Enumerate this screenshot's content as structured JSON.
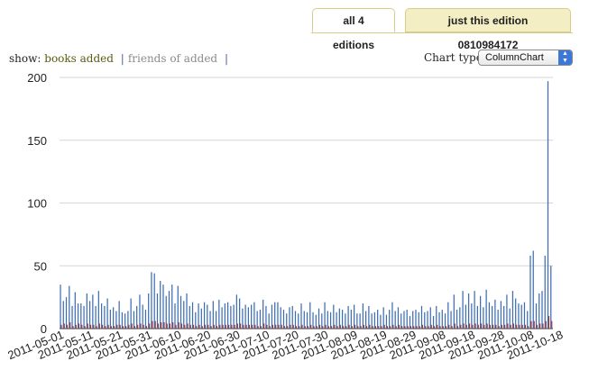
{
  "tabs": [
    {
      "label": "all 4 editions",
      "active": true
    },
    {
      "label": "just this edition 0810984172",
      "active": false
    }
  ],
  "show": {
    "label": "show:",
    "options": [
      "books added",
      "friends of added"
    ],
    "separator": "|"
  },
  "chart_type": {
    "label": "Chart type",
    "selected": "ColumnChart"
  },
  "colors": {
    "series_books": "#3d6db3",
    "series_friends": "#9e3b3b",
    "grid": "#d6d6d6",
    "axis_text": "#222222"
  },
  "chart_data": {
    "type": "bar",
    "ylim": [
      0,
      200
    ],
    "yticks": [
      0,
      50,
      100,
      150,
      200
    ],
    "grid": true,
    "xtick_labels": [
      "2011-05-01",
      "2011-05-11",
      "2011-05-21",
      "2011-05-31",
      "2011-06-10",
      "2011-06-20",
      "2011-06-30",
      "2011-07-10",
      "2011-07-20",
      "2011-07-30",
      "2011-08-09",
      "2011-08-19",
      "2011-08-29",
      "2011-09-08",
      "2011-09-18",
      "2011-09-28",
      "2011-10-08",
      "2011-10-18"
    ],
    "start_date": "2011-05-01",
    "series": [
      {
        "values": [
          35,
          22,
          25,
          34,
          18,
          29,
          20,
          20,
          18,
          28,
          22,
          27,
          18,
          30,
          20,
          18,
          24,
          15,
          17,
          14,
          22,
          13,
          12,
          14,
          24,
          14,
          18,
          27,
          19,
          15,
          28,
          45,
          44,
          28,
          38,
          35,
          26,
          30,
          35,
          20,
          34,
          26,
          22,
          28,
          18,
          21,
          13,
          20,
          16,
          21,
          19,
          14,
          22,
          14,
          23,
          17,
          20,
          21,
          18,
          19,
          27,
          24,
          16,
          19,
          17,
          19,
          21,
          14,
          15,
          23,
          18,
          12,
          19,
          21,
          21,
          17,
          15,
          12,
          17,
          18,
          14,
          12,
          20,
          14,
          13,
          21,
          13,
          11,
          16,
          12,
          21,
          14,
          13,
          19,
          13,
          16,
          15,
          12,
          18,
          15,
          19,
          12,
          12,
          20,
          14,
          18,
          12,
          13,
          15,
          11,
          17,
          11,
          15,
          21,
          14,
          17,
          12,
          14,
          15,
          10,
          14,
          15,
          13,
          18,
          13,
          14,
          17,
          10,
          18,
          13,
          15,
          12,
          21,
          14,
          27,
          15,
          17,
          30,
          19,
          28,
          20,
          30,
          18,
          26,
          17,
          31,
          21,
          18,
          23,
          15,
          22,
          18,
          27,
          16,
          30,
          24,
          20,
          19,
          21,
          14,
          58,
          62,
          20,
          28,
          30,
          58,
          197,
          50
        ]
      },
      {
        "values": [
          3,
          4,
          3,
          5,
          2,
          3,
          4,
          3,
          2,
          4,
          3,
          3,
          2,
          4,
          3,
          2,
          3,
          2,
          2,
          3,
          3,
          2,
          2,
          3,
          4,
          2,
          3,
          4,
          3,
          2,
          4,
          6,
          6,
          4,
          5,
          5,
          4,
          4,
          5,
          3,
          5,
          4,
          3,
          4,
          3,
          3,
          2,
          3,
          2,
          3,
          3,
          2,
          3,
          2,
          3,
          3,
          3,
          3,
          3,
          3,
          4,
          4,
          3,
          3,
          3,
          3,
          3,
          2,
          2,
          4,
          3,
          2,
          3,
          3,
          3,
          3,
          2,
          2,
          3,
          3,
          2,
          2,
          3,
          2,
          2,
          3,
          2,
          2,
          3,
          2,
          3,
          2,
          2,
          3,
          2,
          3,
          2,
          2,
          3,
          2,
          3,
          2,
          2,
          3,
          2,
          3,
          2,
          2,
          2,
          2,
          3,
          2,
          2,
          3,
          2,
          3,
          2,
          2,
          2,
          2,
          2,
          2,
          2,
          3,
          2,
          2,
          3,
          2,
          3,
          2,
          2,
          2,
          3,
          2,
          4,
          2,
          3,
          4,
          3,
          4,
          3,
          4,
          3,
          4,
          3,
          4,
          3,
          3,
          3,
          2,
          3,
          3,
          4,
          3,
          4,
          3,
          3,
          3,
          3,
          2,
          6,
          6,
          3,
          4,
          4,
          6,
          10,
          6
        ]
      }
    ]
  }
}
